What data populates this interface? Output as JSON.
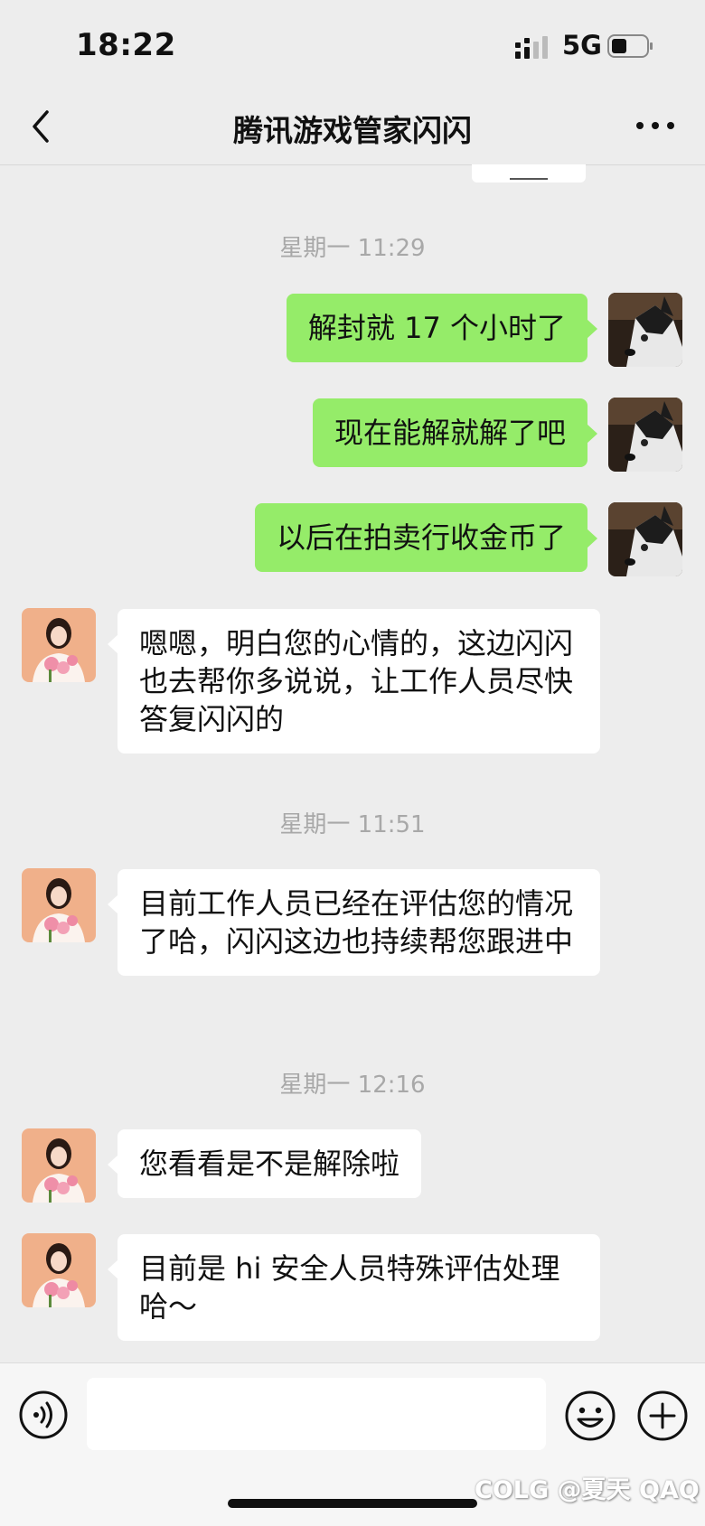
{
  "status_bar": {
    "time": "18:22",
    "network": "5G"
  },
  "header": {
    "title": "腾讯游戏管家闪闪"
  },
  "messages": [
    {
      "kind": "timestamp",
      "text": "星期一 11:29"
    },
    {
      "kind": "outgoing",
      "text": "解封就 17 个小时了"
    },
    {
      "kind": "outgoing",
      "text": "现在能解就解了吧"
    },
    {
      "kind": "outgoing",
      "text": "以后在拍卖行收金币了"
    },
    {
      "kind": "incoming",
      "text": "嗯嗯，明白您的心情的，这边闪闪也去帮你多说说，让工作人员尽快答复闪闪的"
    },
    {
      "kind": "timestamp",
      "text": "星期一 11:51"
    },
    {
      "kind": "incoming",
      "text": "目前工作人员已经在评估您的情况了哈，闪闪这边也持续帮您跟进中"
    },
    {
      "kind": "timestamp",
      "text": "星期一 12:16"
    },
    {
      "kind": "incoming",
      "text": "您看看是不是解除啦"
    },
    {
      "kind": "incoming",
      "text": "目前是 hi 安全人员特殊评估处理哈～"
    }
  ],
  "input_bar": {
    "placeholder": ""
  },
  "watermark": "@夏天 QAQ",
  "watermark_logo": "COLG",
  "colors": {
    "background": "#ededed",
    "outgoing_bubble": "#95ec69",
    "incoming_bubble": "#ffffff",
    "timestamp": "#a8a8a8"
  },
  "icons": [
    "back-icon",
    "more-icon",
    "voice-icon",
    "emoji-icon",
    "plus-icon"
  ]
}
